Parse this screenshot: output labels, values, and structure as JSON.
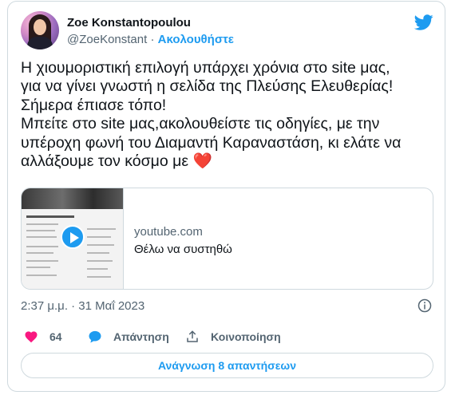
{
  "author": {
    "display_name": "Zoe Konstantopoulou",
    "handle": "@ZoeKonstant",
    "separator": "·",
    "follow_label": "Ακολουθήστε"
  },
  "tweet": {
    "lines": [
      "Η χιουμοριστική επιλογή υπάρχει χρόνια στο site μας,",
      "για να γίνει γνωστή η σελίδα της Πλεύσης Ελευθερίας!",
      "Σήμερα έπιασε τόπο!",
      "Μπείτε στο site μας,ακολουθείστε τις οδηγίες, με την",
      "υπέροχη φωνή του Διαμαντή Καραναστάση, κι ελάτε να",
      "αλλάξουμε τον κόσμο με"
    ],
    "emoji": "❤️"
  },
  "link_card": {
    "domain": "youtube.com",
    "title": "Θέλω να συστηθώ"
  },
  "timestamp": "2:37 μ.μ. · 31 Μαΐ 2023",
  "actions": {
    "likes_count": "64",
    "reply_label": "Απάντηση",
    "share_label": "Κοινοποίηση"
  },
  "read_replies_label": "Ανάγνωση 8 απαντήσεων",
  "colors": {
    "accent": "#1d9bf0",
    "like": "#f91880",
    "text": "#0f1419",
    "muted": "#536471",
    "border": "#cfd9de"
  },
  "icons": [
    "twitter-bird-icon",
    "info-icon",
    "heart-icon",
    "reply-bubble-icon",
    "share-icon",
    "play-icon"
  ]
}
